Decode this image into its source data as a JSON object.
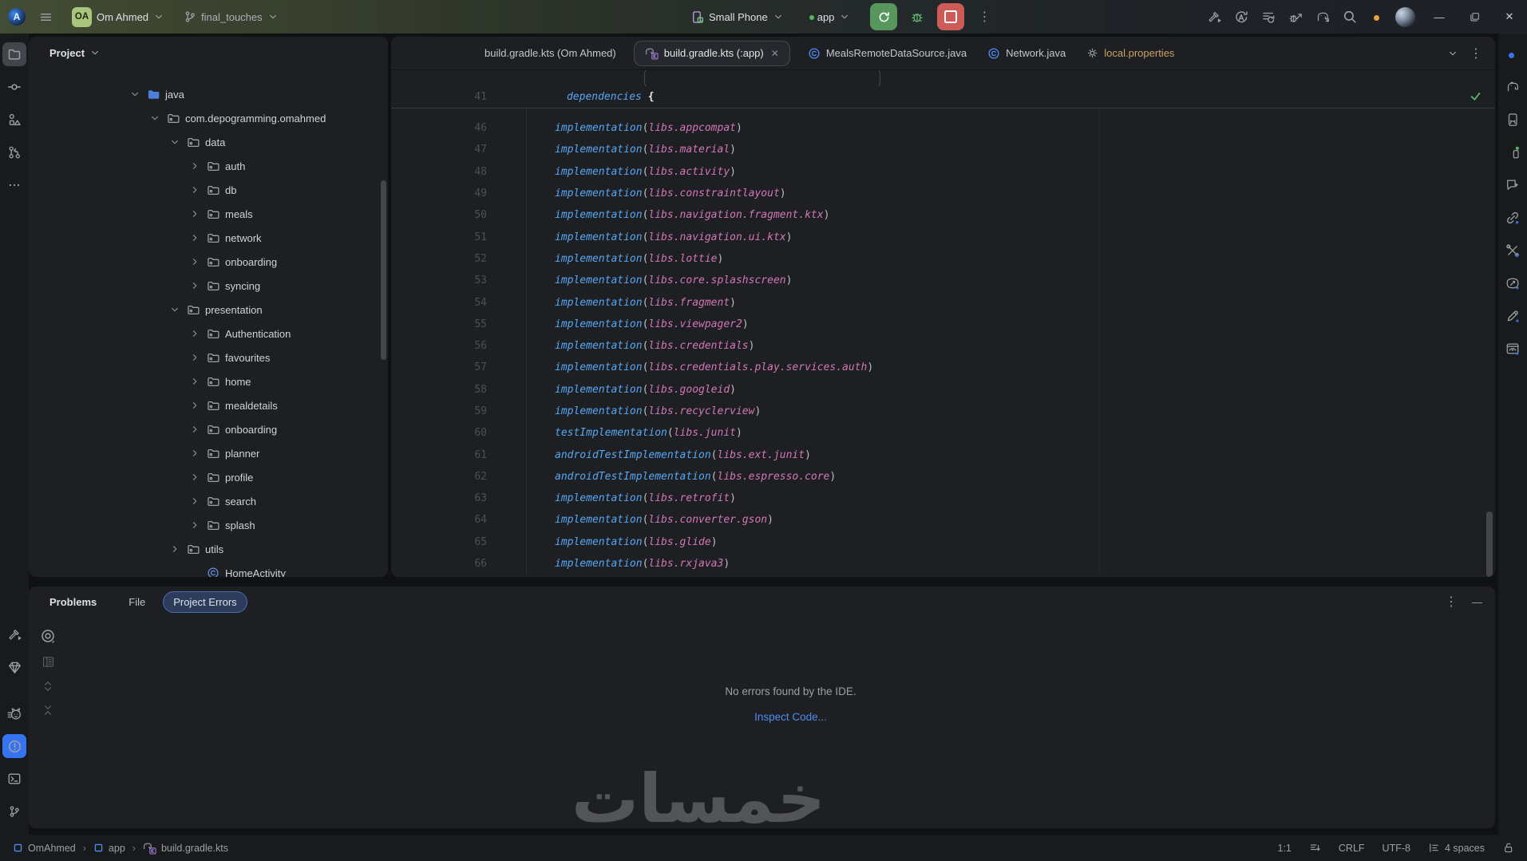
{
  "titlebar": {
    "logo_letter": "A",
    "project_badge": "OA",
    "project_name": "Om Ahmed",
    "branch_name": "final_touches",
    "device_selector": "Small Phone",
    "run_config": "app",
    "actions": [
      "build",
      "apply-changes",
      "apply-code-changes",
      "attach-debugger",
      "sync-gradle",
      "search",
      "settings",
      "profile"
    ],
    "window_controls": [
      "minimize",
      "restore",
      "close"
    ]
  },
  "left_strip": {
    "top_items": [
      "project",
      "commit",
      "structure",
      "pull-requests",
      "more"
    ],
    "bottom_items": [
      "build",
      "app-quality-insights",
      "logcat",
      "problems",
      "terminal",
      "version-control"
    ],
    "selected_top": "project",
    "selected_bottom": "problems"
  },
  "right_strip": {
    "items": [
      "notifications",
      "gradle",
      "device-manager",
      "running-devices",
      "gemini",
      "app-links",
      "assistant-tools",
      "app-insights",
      "compose-editor",
      "preview"
    ]
  },
  "project_panel": {
    "title": "Project",
    "tree": [
      {
        "label": "java",
        "level": 0,
        "chevron": "down",
        "icon": "folder-blue"
      },
      {
        "label": "com.depogramming.omahmed",
        "level": 1,
        "chevron": "down",
        "icon": "package"
      },
      {
        "label": "data",
        "level": 2,
        "chevron": "down",
        "icon": "package"
      },
      {
        "label": "auth",
        "level": 3,
        "chevron": "right",
        "icon": "package"
      },
      {
        "label": "db",
        "level": 3,
        "chevron": "right",
        "icon": "package"
      },
      {
        "label": "meals",
        "level": 3,
        "chevron": "right",
        "icon": "package"
      },
      {
        "label": "network",
        "level": 3,
        "chevron": "right",
        "icon": "package"
      },
      {
        "label": "onboarding",
        "level": 3,
        "chevron": "right",
        "icon": "package"
      },
      {
        "label": "syncing",
        "level": 3,
        "chevron": "right",
        "icon": "package"
      },
      {
        "label": "presentation",
        "level": 2,
        "chevron": "down",
        "icon": "package"
      },
      {
        "label": "Authentication",
        "level": 3,
        "chevron": "right",
        "icon": "package"
      },
      {
        "label": "favourites",
        "level": 3,
        "chevron": "right",
        "icon": "package"
      },
      {
        "label": "home",
        "level": 3,
        "chevron": "right",
        "icon": "package"
      },
      {
        "label": "mealdetails",
        "level": 3,
        "chevron": "right",
        "icon": "package"
      },
      {
        "label": "onboarding",
        "level": 3,
        "chevron": "right",
        "icon": "package"
      },
      {
        "label": "planner",
        "level": 3,
        "chevron": "right",
        "icon": "package"
      },
      {
        "label": "profile",
        "level": 3,
        "chevron": "right",
        "icon": "package"
      },
      {
        "label": "search",
        "level": 3,
        "chevron": "right",
        "icon": "package"
      },
      {
        "label": "splash",
        "level": 3,
        "chevron": "right",
        "icon": "package"
      },
      {
        "label": "utils",
        "level": 2,
        "chevron": "right",
        "icon": "package"
      },
      {
        "label": "HomeActivity",
        "level": 3,
        "chevron": "none",
        "icon": "class"
      }
    ]
  },
  "editor": {
    "tabs": [
      {
        "label": "build.gradle.kts (Om Ahmed)",
        "icon": null,
        "active": false,
        "closable": false,
        "modified": false
      },
      {
        "label": "build.gradle.kts (:app)",
        "icon": "gradle-kts",
        "active": true,
        "closable": true,
        "modified": false
      },
      {
        "label": "MealsRemoteDataSource.java",
        "icon": "java-class",
        "active": false,
        "closable": false,
        "modified": false
      },
      {
        "label": "Network.java",
        "icon": "java-class",
        "active": false,
        "closable": false,
        "modified": false
      },
      {
        "label": "local.properties",
        "icon": "gear-file",
        "active": false,
        "closable": false,
        "modified": true
      }
    ],
    "close_glyph": "✕",
    "sticky_line": {
      "number": "41",
      "function": "dependencies",
      "brace": "{"
    },
    "lines": [
      {
        "n": "46",
        "fn": "implementation",
        "arg": "libs.appcompat"
      },
      {
        "n": "47",
        "fn": "implementation",
        "arg": "libs.material"
      },
      {
        "n": "48",
        "fn": "implementation",
        "arg": "libs.activity"
      },
      {
        "n": "49",
        "fn": "implementation",
        "arg": "libs.constraintlayout"
      },
      {
        "n": "50",
        "fn": "implementation",
        "arg": "libs.navigation.fragment.ktx"
      },
      {
        "n": "51",
        "fn": "implementation",
        "arg": "libs.navigation.ui.ktx"
      },
      {
        "n": "52",
        "fn": "implementation",
        "arg": "libs.lottie"
      },
      {
        "n": "53",
        "fn": "implementation",
        "arg": "libs.core.splashscreen"
      },
      {
        "n": "54",
        "fn": "implementation",
        "arg": "libs.fragment"
      },
      {
        "n": "55",
        "fn": "implementation",
        "arg": "libs.viewpager2"
      },
      {
        "n": "56",
        "fn": "implementation",
        "arg": "libs.credentials"
      },
      {
        "n": "57",
        "fn": "implementation",
        "arg": "libs.credentials.play.services.auth"
      },
      {
        "n": "58",
        "fn": "implementation",
        "arg": "libs.googleid"
      },
      {
        "n": "59",
        "fn": "implementation",
        "arg": "libs.recyclerview"
      },
      {
        "n": "60",
        "fn": "testImplementation",
        "arg": "libs.junit"
      },
      {
        "n": "61",
        "fn": "androidTestImplementation",
        "arg": "libs.ext.junit"
      },
      {
        "n": "62",
        "fn": "androidTestImplementation",
        "arg": "libs.espresso.core"
      },
      {
        "n": "63",
        "fn": "implementation",
        "arg": "libs.retrofit"
      },
      {
        "n": "64",
        "fn": "implementation",
        "arg": "libs.converter.gson"
      },
      {
        "n": "65",
        "fn": "implementation",
        "arg": "libs.glide"
      },
      {
        "n": "66",
        "fn": "implementation",
        "arg": "libs.rxjava3"
      }
    ]
  },
  "problems": {
    "title": "Problems",
    "tab_file": "File",
    "tab_project_errors": "Project Errors",
    "empty_text": "No errors found by the IDE.",
    "inspect_link": "Inspect Code...",
    "toolbar_icons": [
      "view-options-eye",
      "preview-panel",
      "expand-all",
      "collapse-all"
    ]
  },
  "statusbar": {
    "breadcrumbs": [
      {
        "icon": "module",
        "label": "OmAhmed"
      },
      {
        "icon": "module",
        "label": "app"
      },
      {
        "icon": "gradle-kts",
        "label": "build.gradle.kts"
      }
    ],
    "caret_position": "1:1",
    "line_separator": "CRLF",
    "encoding": "UTF-8",
    "indent": "4 spaces"
  },
  "watermark": "خمسات",
  "glyphs": {
    "kebab": "⋮",
    "close": "✕",
    "minus": "—"
  },
  "colors": {
    "accent_blue": "#3574f0",
    "run_green": "#57975d",
    "stop_red": "#cd5c58",
    "debug_green": "#62b369",
    "modified_tab_orange": "#cfa05f",
    "link_blue": "#4e8bf5",
    "code_function_blue": "#56a8f5",
    "code_property_pink": "#d277b8",
    "inspection_check_green": "#5fb865",
    "settings_badge_orange": "#e8a33d",
    "project_badge_green": "#a9c47d",
    "panel_bg": "#1e1f22"
  }
}
